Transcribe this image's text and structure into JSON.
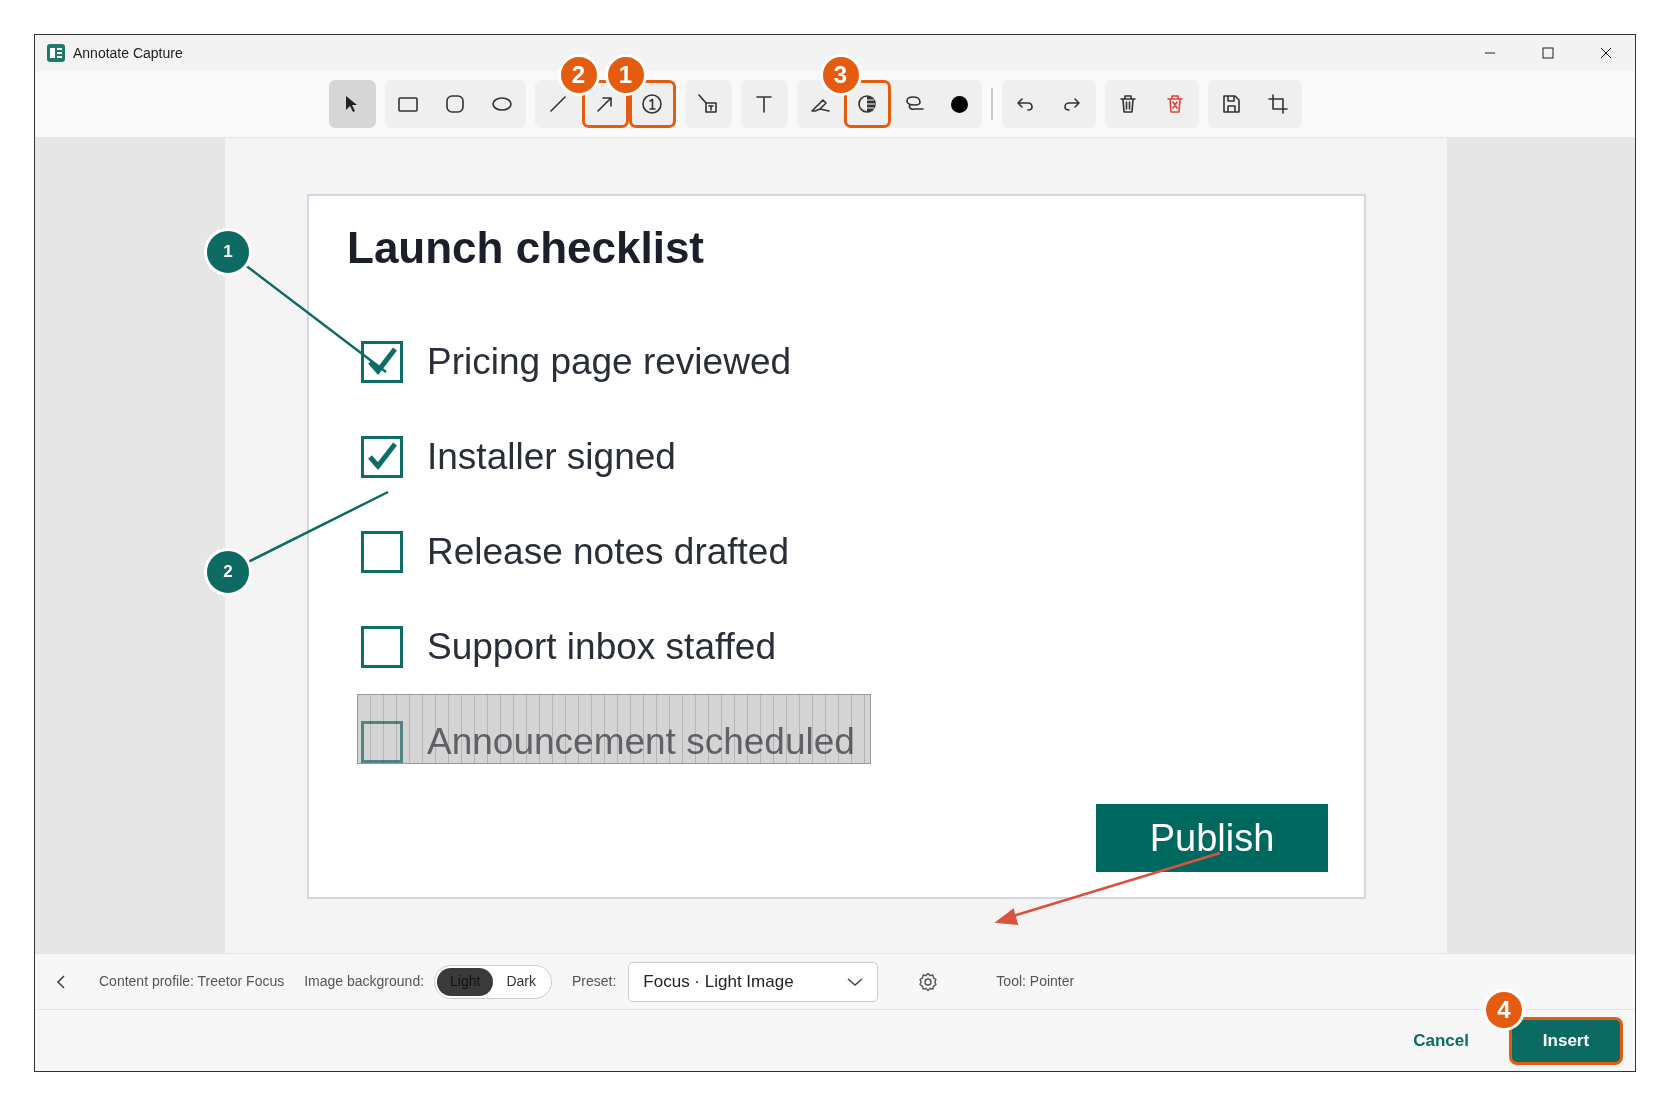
{
  "window": {
    "title": "Annotate Capture"
  },
  "toolbar": [
    {
      "tools": [
        {
          "kind": "pointer",
          "selected": true
        }
      ]
    },
    {
      "tools": [
        {
          "kind": "rectangle",
          "selected": false
        },
        {
          "kind": "rounded",
          "selected": false
        },
        {
          "kind": "ellipse",
          "selected": false
        }
      ]
    },
    {
      "tools": [
        {
          "kind": "line",
          "selected": false
        },
        {
          "kind": "arrow",
          "selected": false,
          "callout": "2"
        },
        {
          "kind": "number",
          "selected": false,
          "callout": "1"
        }
      ]
    },
    {
      "tools": [
        {
          "kind": "callout",
          "selected": false
        }
      ]
    },
    {
      "tools": [
        {
          "kind": "text",
          "selected": false
        }
      ]
    },
    {
      "tools": [
        {
          "kind": "highlighter",
          "selected": false
        },
        {
          "kind": "contrast",
          "selected": false,
          "callout": "3"
        },
        {
          "kind": "lasso",
          "selected": false
        },
        {
          "kind": "color",
          "selected": false,
          "color": "#000000"
        }
      ]
    },
    {
      "tools": [
        {
          "kind": "undo",
          "selected": false
        },
        {
          "kind": "redo",
          "selected": false
        }
      ]
    },
    {
      "tools": [
        {
          "kind": "delete",
          "selected": false
        },
        {
          "kind": "clear",
          "selected": false
        }
      ]
    },
    {
      "tools": [
        {
          "kind": "save",
          "selected": false
        },
        {
          "kind": "crop",
          "selected": false
        }
      ]
    }
  ],
  "capture": {
    "title": "Launch checklist",
    "items": [
      {
        "label": "Pricing page reviewed",
        "checked": true,
        "redacted": false
      },
      {
        "label": "Installer signed",
        "checked": true,
        "redacted": false
      },
      {
        "label": "Release notes drafted",
        "checked": false,
        "redacted": false
      },
      {
        "label": "Support inbox staffed",
        "checked": false,
        "redacted": false
      },
      {
        "label": "Announcement scheduled",
        "checked": false,
        "redacted": true
      }
    ],
    "button": "Publish"
  },
  "annotations": [
    {
      "kind": "step",
      "label": "1"
    },
    {
      "kind": "step",
      "label": "2"
    },
    {
      "kind": "arrow"
    }
  ],
  "options_bar": {
    "profile": "Content profile: Treetor Focus",
    "background_label": "Image background:",
    "background_options": [
      {
        "label": "Light",
        "selected": true
      },
      {
        "label": "Dark",
        "selected": false
      }
    ],
    "preset_label": "Preset:",
    "preset": "Focus · Light Image",
    "tool": "Tool: Pointer"
  },
  "footer": {
    "cancel": "Cancel",
    "insert": "Insert",
    "insert_callout": "4"
  }
}
